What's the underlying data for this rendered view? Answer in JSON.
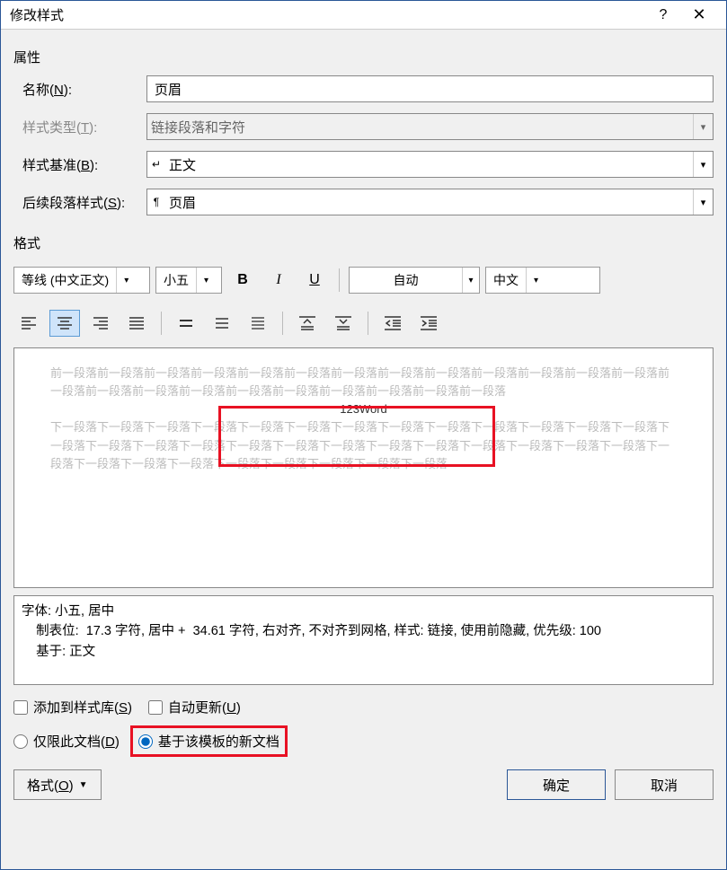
{
  "title": "修改样式",
  "section_props": "属性",
  "fields": {
    "name_label": "名称(N):",
    "name_value": "页眉",
    "type_label": "样式类型(T):",
    "type_value": "链接段落和字符",
    "based_label": "样式基准(B):",
    "based_value": "正文",
    "follow_label": "后续段落样式(S):",
    "follow_value": "页眉"
  },
  "section_format": "格式",
  "font_name": "等线 (中文正文)",
  "font_size": "小五",
  "font_color": "自动",
  "font_lang": "中文",
  "preview": {
    "prev": "前一段落前一段落前一段落前一段落前一段落前一段落前一段落前一段落前一段落前一段落前一段落前一段落前一段落前一段落前一段落前一段落前一段落前一段落前一段落前一段落前一段落前一段落前一段落",
    "sample": "123Word",
    "next": "下一段落下一段落下一段落下一段落下一段落下一段落下一段落下一段落下一段落下一段落下一段落下一段落下一段落下一段落下一段落下一段落下一段落下一段落下一段落下一段落下一段落下一段落下一段落下一段落下一段落下一段落下一段落下一段落下一段落下一段落下一段落下一段落下一段落下一段落下一段落"
  },
  "description": {
    "line1": "字体: 小五, 居中",
    "line2": "    制表位:  17.3 字符, 居中 +  34.61 字符, 右对齐, 不对齐到网格, 样式: 链接, 使用前隐藏, 优先级: 100",
    "line3": "    基于: 正文"
  },
  "checks": {
    "add_gallery": "添加到样式库(S)",
    "auto_update": "自动更新(U)"
  },
  "radios": {
    "only_doc": "仅限此文档(D)",
    "template": "基于该模板的新文档"
  },
  "format_btn": "格式(O)",
  "ok": "确定",
  "cancel": "取消"
}
